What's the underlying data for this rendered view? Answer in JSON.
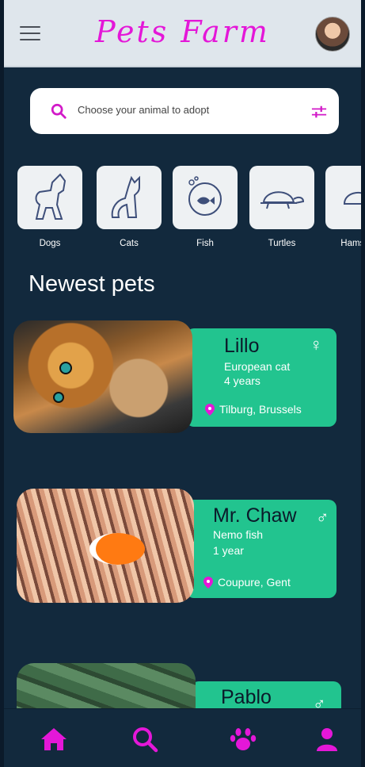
{
  "header": {
    "title": "Pets Farm",
    "menu_icon": "menu-icon",
    "avatar_icon": "avatar"
  },
  "search": {
    "placeholder": "Choose your animal to adopt",
    "icon": "search-icon",
    "filter_icon": "filter-icon"
  },
  "categories": [
    {
      "label": "Dogs",
      "icon": "dog-icon"
    },
    {
      "label": "Cats",
      "icon": "cat-icon"
    },
    {
      "label": "Fish",
      "icon": "fishbowl-icon"
    },
    {
      "label": "Turtles",
      "icon": "turtle-icon"
    },
    {
      "label": "Hamster",
      "icon": "hamster-icon"
    }
  ],
  "section": {
    "title": "Newest pets"
  },
  "pets": [
    {
      "name": "Lillo",
      "breed": "European cat",
      "age": "4 years",
      "location": "Tilburg, Brussels",
      "gender": "♀"
    },
    {
      "name": "Mr. Chaw",
      "breed": "Nemo fish",
      "age": "1 year",
      "location": "Coupure, Gent",
      "gender": "♂"
    },
    {
      "name": "Pablo",
      "gender": "♂"
    }
  ],
  "bottom_nav": [
    {
      "name": "home",
      "icon": "home-icon"
    },
    {
      "name": "search",
      "icon": "search-icon"
    },
    {
      "name": "paw",
      "icon": "paw-icon"
    },
    {
      "name": "profile",
      "icon": "user-icon"
    }
  ],
  "colors": {
    "accent": "#e417d8",
    "card": "#22c48f",
    "background": "#12293d",
    "topbar": "#dfe6ec"
  }
}
